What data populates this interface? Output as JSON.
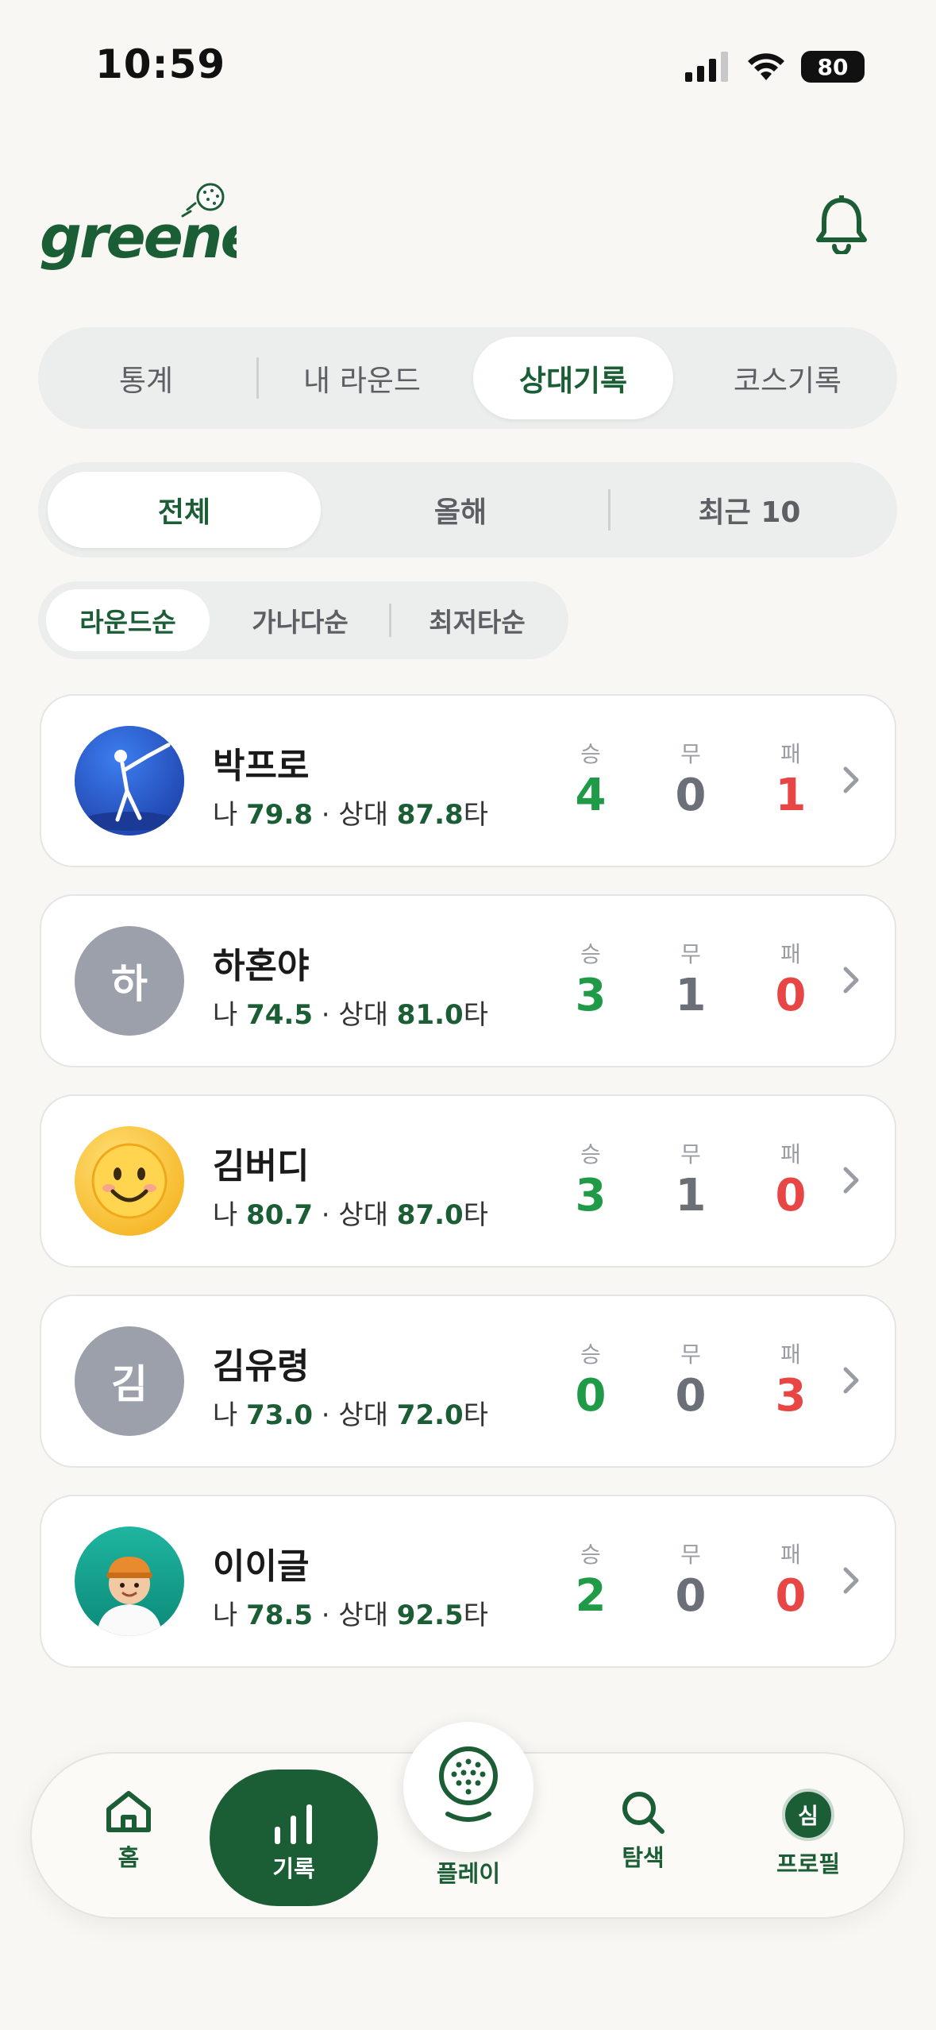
{
  "status_bar": {
    "time": "10:59",
    "battery": "80"
  },
  "header": {
    "logo_text": "greener"
  },
  "main_tabs": [
    {
      "label": "통계"
    },
    {
      "label": "내 라운드"
    },
    {
      "label": "상대기록",
      "active": true
    },
    {
      "label": "코스기록"
    }
  ],
  "period_tabs": [
    {
      "label": "전체",
      "active": true
    },
    {
      "label": "올해"
    },
    {
      "label": "최근 10"
    }
  ],
  "sort_tabs": [
    {
      "label": "라운드순",
      "active": true
    },
    {
      "label": "가나다순"
    },
    {
      "label": "최저타순"
    }
  ],
  "labels": {
    "me": "나",
    "opponent": "상대",
    "strokes_suffix": "타",
    "win": "승",
    "draw": "무",
    "loss": "패"
  },
  "opponents": [
    {
      "name": "박프로",
      "avatar": "golfer-avatar",
      "my_avg": "79.8",
      "opp_avg": "87.8",
      "win": "4",
      "draw": "0",
      "loss": "1"
    },
    {
      "name": "하혼야",
      "avatar": "initial",
      "initial": "하",
      "my_avg": "74.5",
      "opp_avg": "81.0",
      "win": "3",
      "draw": "1",
      "loss": "0"
    },
    {
      "name": "김버디",
      "avatar": "smiley-avatar",
      "my_avg": "80.7",
      "opp_avg": "87.0",
      "win": "3",
      "draw": "1",
      "loss": "0"
    },
    {
      "name": "김유령",
      "avatar": "initial",
      "initial": "김",
      "my_avg": "73.0",
      "opp_avg": "72.0",
      "win": "0",
      "draw": "0",
      "loss": "3"
    },
    {
      "name": "이이글",
      "avatar": "cap-person-avatar",
      "my_avg": "78.5",
      "opp_avg": "92.5",
      "win": "2",
      "draw": "0",
      "loss": "0"
    }
  ],
  "bottom_nav": {
    "home": "홈",
    "records": "기록",
    "play": "플레이",
    "search": "탐색",
    "profile": "프로필",
    "profile_initial": "심"
  },
  "colors": {
    "brand": "#1b5e36",
    "win": "#1f9a47",
    "draw": "#6b6f77",
    "loss": "#e84545"
  }
}
